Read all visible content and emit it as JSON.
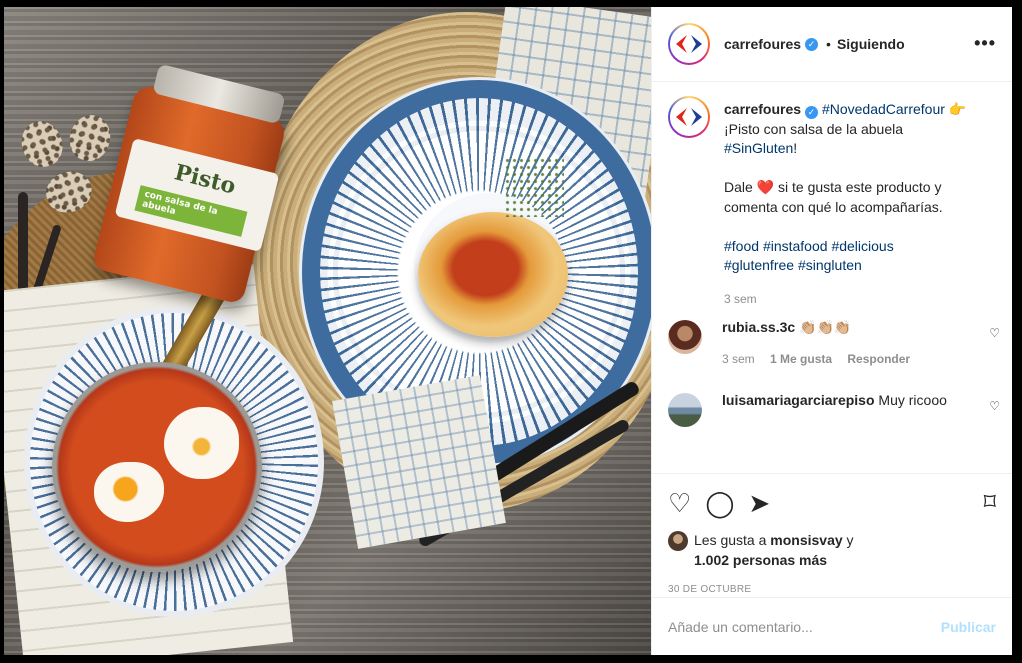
{
  "post": {
    "image_alt": "Carrefour pisto con salsa de la abuela",
    "jar_label": "Pisto",
    "jar_sublabel": "con salsa de la abuela"
  },
  "header": {
    "username": "carrefoures",
    "verified_icon": "verified-badge-icon",
    "separator": "•",
    "follow_label": "Siguiendo",
    "more_icon": "•••"
  },
  "caption": {
    "username": "carrefoures",
    "hashtag_novedad": "#NovedadCarrefour",
    "emoji_point": "👉",
    "line1": "¡Pisto con salsa de la abuela",
    "hashtag_singluten_cap": "#SinGluten",
    "excl": "!",
    "dale": "Dale",
    "heart": "❤️",
    "line2": "si te gusta este producto y comenta con qué lo acompañarías.",
    "tag_food": "#food",
    "tag_instafood": "#instafood",
    "tag_delicious": "#delicious",
    "tag_glutenfree": "#glutenfree",
    "tag_singluten": "#singluten",
    "time": "3 sem"
  },
  "comments": [
    {
      "username": "rubia.ss.3c",
      "text": "👏🏼👏🏼👏🏼",
      "time": "3 sem",
      "likes": "1 Me gusta",
      "reply": "Responder"
    },
    {
      "username": "luisamariagarciarepiso",
      "text": "Muy ricooo"
    }
  ],
  "actions": {
    "like_icon": "♡",
    "comment_icon": "◯",
    "share_icon": "➤",
    "save_icon": "⌑",
    "likes_prefix": "Les gusta a",
    "likes_user": "monsisvay",
    "likes_and": "y",
    "likes_count": "1.002 personas más",
    "date": "30 DE OCTUBRE"
  },
  "add_comment": {
    "placeholder": "Añade un comentario...",
    "publish_label": "Publicar"
  },
  "colors": {
    "link": "#00376b",
    "muted": "#8e8e8e",
    "publish_disabled": "#b2dffc",
    "carrefour_red": "#e2231a",
    "carrefour_blue": "#1c3f94"
  }
}
